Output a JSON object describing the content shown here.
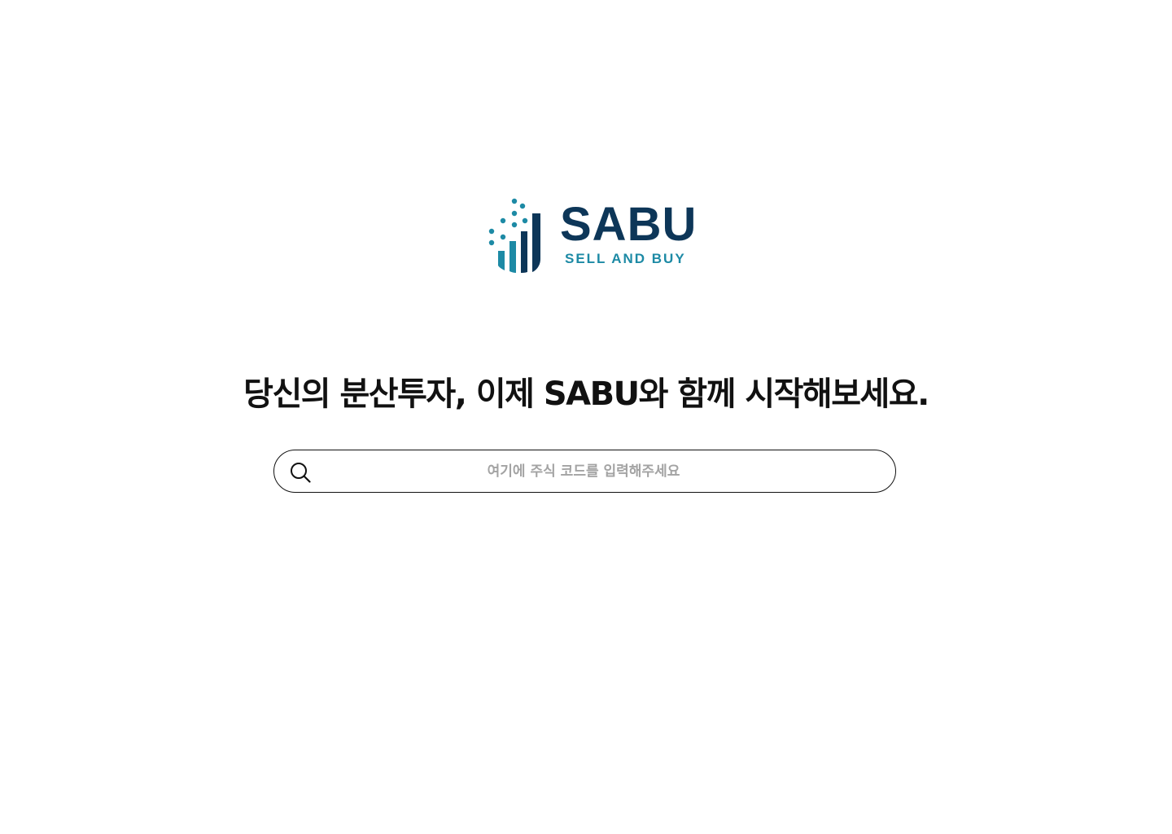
{
  "brand": {
    "name": "SABU",
    "tagline": "SELL AND BUY",
    "colors": {
      "navy": "#0d3658",
      "teal": "#1d8aa5"
    }
  },
  "hero": {
    "headline": "당신의 분산투자, 이제 SABU와 함께 시작해보세요."
  },
  "search": {
    "icon": "search-icon",
    "value": "",
    "placeholder": "여기에 주식 코드를 입력해주세요"
  }
}
